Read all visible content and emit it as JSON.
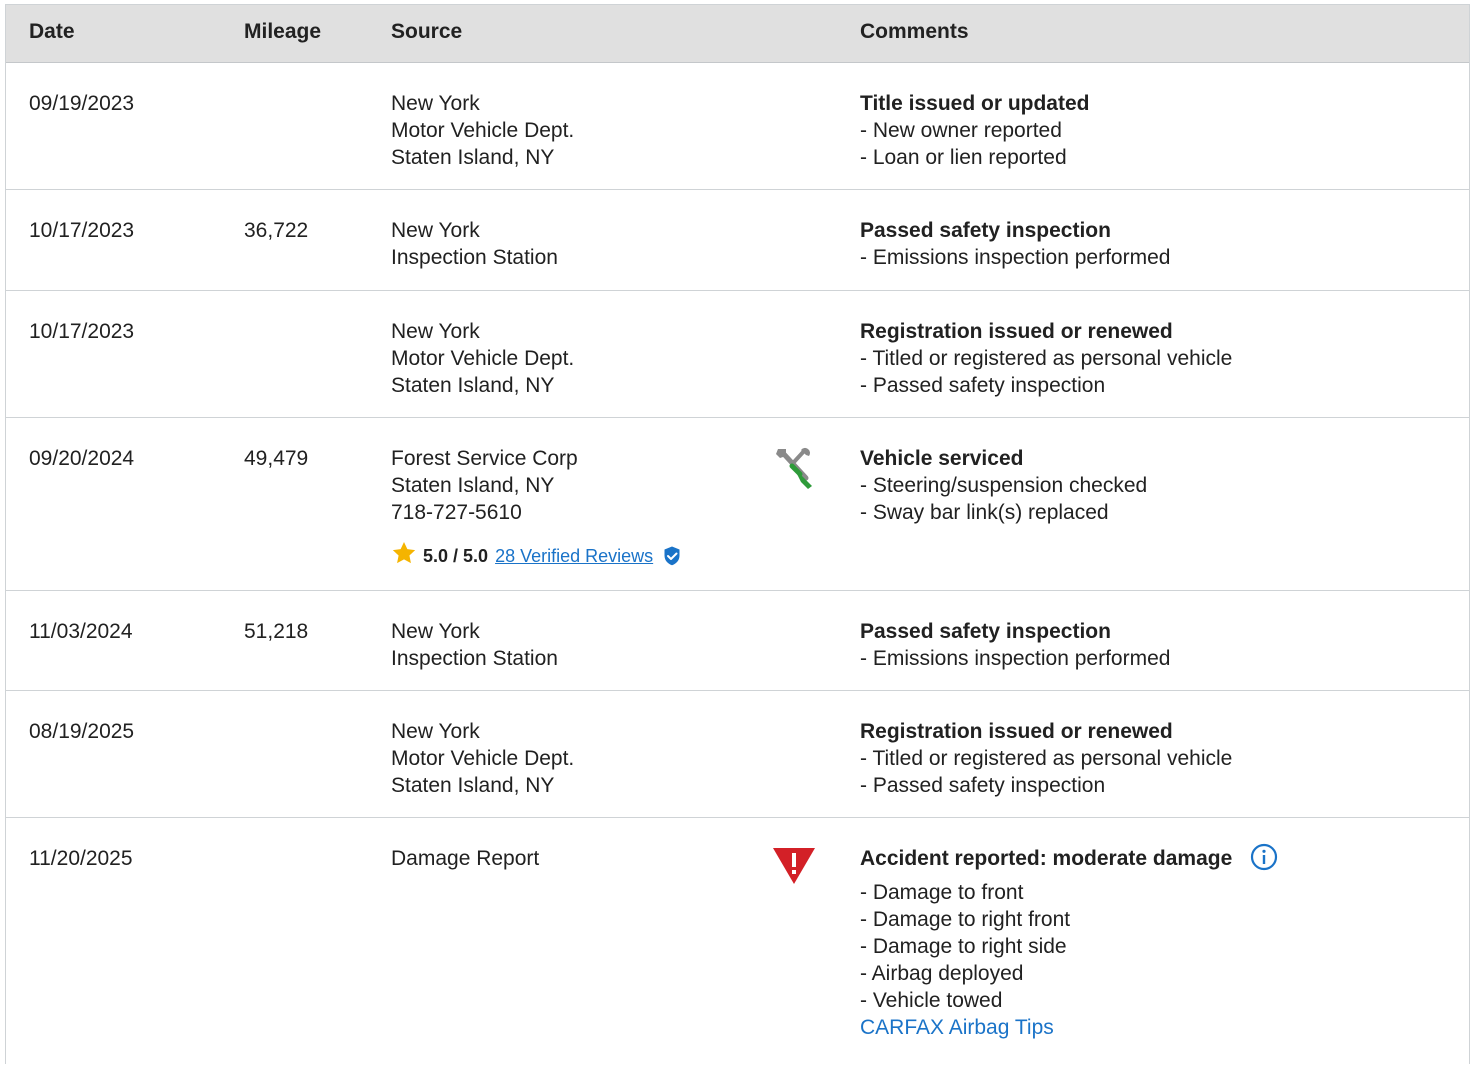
{
  "headers": {
    "date": "Date",
    "mileage": "Mileage",
    "source": "Source",
    "comments": "Comments"
  },
  "rows": [
    {
      "date": "09/19/2023",
      "mileage": "",
      "source": [
        "New York",
        "Motor Vehicle Dept.",
        "Staten Island, NY"
      ],
      "title": "Title issued or updated",
      "items": [
        "- New owner reported",
        "- Loan or lien reported"
      ]
    },
    {
      "date": "10/17/2023",
      "mileage": "36,722",
      "source": [
        "New York",
        "Inspection Station"
      ],
      "title": "Passed safety inspection",
      "items": [
        "- Emissions inspection performed"
      ]
    },
    {
      "date": "10/17/2023",
      "mileage": "",
      "source": [
        "New York",
        "Motor Vehicle Dept.",
        "Staten Island, NY"
      ],
      "title": "Registration issued or renewed",
      "items": [
        "- Titled or registered as personal vehicle",
        "- Passed safety inspection"
      ]
    },
    {
      "date": "09/20/2024",
      "mileage": "49,479",
      "source": [
        "Forest Service Corp",
        "Staten Island, NY",
        "718-727-5610"
      ],
      "rating": {
        "score": "5.0 / 5.0",
        "reviews_link": "28 Verified Reviews"
      },
      "icon": "wrench-screwdriver-icon",
      "title": "Vehicle serviced",
      "items": [
        "- Steering/suspension checked",
        "- Sway bar link(s) replaced"
      ]
    },
    {
      "date": "11/03/2024",
      "mileage": "51,218",
      "source": [
        "New York",
        "Inspection Station"
      ],
      "title": "Passed safety inspection",
      "items": [
        "- Emissions inspection performed"
      ]
    },
    {
      "date": "08/19/2025",
      "mileage": "",
      "source": [
        "New York",
        "Motor Vehicle Dept.",
        "Staten Island, NY"
      ],
      "title": "Registration issued or renewed",
      "items": [
        "- Titled or registered as personal vehicle",
        "- Passed safety inspection"
      ]
    },
    {
      "date": "11/20/2025",
      "mileage": "",
      "source": [
        "Damage Report"
      ],
      "icon": "damage-warning-icon",
      "title": "Accident reported: moderate damage",
      "items": [
        "- Damage to front",
        "- Damage to right front",
        "- Damage to right side",
        "- Airbag deployed",
        "- Vehicle towed"
      ],
      "link": "CARFAX Airbag Tips"
    }
  ],
  "colors": {
    "header_bg": "#e0e0e0",
    "link": "#1a73c8",
    "warning": "#d32027",
    "tool_green": "#2e9b3a",
    "star": "#f5b400"
  }
}
